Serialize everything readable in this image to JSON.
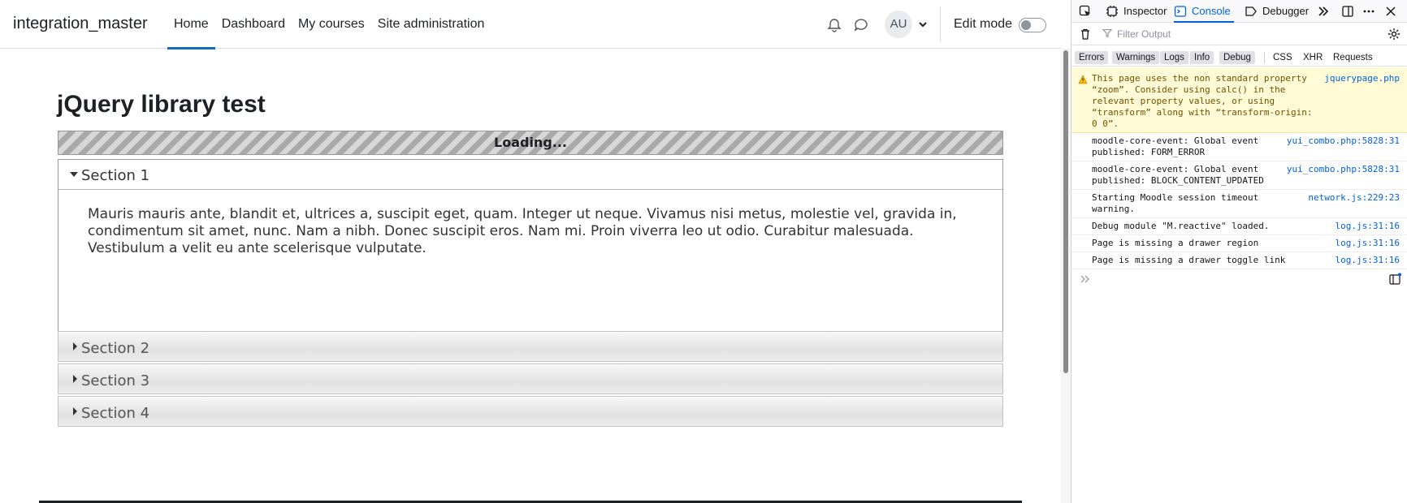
{
  "site": {
    "brand": "integration_master",
    "nav": [
      {
        "label": "Home",
        "active": true
      },
      {
        "label": "Dashboard",
        "active": false
      },
      {
        "label": "My courses",
        "active": false
      },
      {
        "label": "Site administration",
        "active": false
      }
    ],
    "user_initials": "AU",
    "edit_mode_label": "Edit mode",
    "edit_mode_on": false
  },
  "main": {
    "title": "jQuery library test",
    "loading_text": "Loading...",
    "sections": [
      {
        "label": "Section 1",
        "expanded": true,
        "body": "Mauris mauris ante, blandit et, ultrices a, suscipit eget, quam. Integer ut neque. Vivamus nisi metus, molestie vel, gravida in, condimentum sit amet, nunc. Nam a nibh. Donec suscipit eros. Nam mi. Proin viverra leo ut odio. Curabitur malesuada. Vestibulum a velit eu ante scelerisque vulputate."
      },
      {
        "label": "Section 2",
        "expanded": false
      },
      {
        "label": "Section 3",
        "expanded": false
      },
      {
        "label": "Section 4",
        "expanded": false
      }
    ]
  },
  "devtools": {
    "tabs": [
      "Inspector",
      "Console",
      "Debugger"
    ],
    "active_tab": "Console",
    "filter_placeholder": "Filter Output",
    "levels": [
      {
        "label": "Errors",
        "on": true
      },
      {
        "label": "Warnings",
        "on": true
      },
      {
        "label": "Logs",
        "on": true
      },
      {
        "label": "Info",
        "on": true
      },
      {
        "label": "Debug",
        "on": true
      },
      {
        "label": "CSS",
        "on": false
      },
      {
        "label": "XHR",
        "on": false
      },
      {
        "label": "Requests",
        "on": false
      }
    ],
    "messages": [
      {
        "type": "warning",
        "text": "This page uses the non standard property\n“zoom”. Consider using calc() in the\nrelevant property values, or using\n“transform” along with “transform-origin:\n0 0”.",
        "source": "jquerypage.php"
      },
      {
        "type": "log",
        "text": "moodle-core-event: Global event\npublished: FORM_ERROR",
        "source": "yui_combo.php:5828:31"
      },
      {
        "type": "log",
        "text": "moodle-core-event: Global event\npublished: BLOCK_CONTENT_UPDATED",
        "source": "yui_combo.php:5828:31"
      },
      {
        "type": "log",
        "text": "Starting Moodle session timeout\nwarning.",
        "source": "network.js:229:23"
      },
      {
        "type": "log",
        "text": "Debug module \"M.reactive\" loaded.",
        "source": "log.js:31:16"
      },
      {
        "type": "log",
        "text": "Page is missing a drawer region",
        "source": "log.js:31:16"
      },
      {
        "type": "log",
        "text": "Page is missing a drawer toggle link",
        "source": "log.js:31:16"
      }
    ],
    "icons": [
      "pick-element-icon",
      "inspector-icon",
      "console-icon",
      "debugger-icon",
      "more-tabs-icon",
      "dock-icon",
      "menu-icon",
      "close-icon",
      "trash-icon",
      "filter-icon",
      "settings-icon",
      "prompt-icon",
      "split-console-icon"
    ],
    "accent": "#0061e0",
    "warning_bg": "#fffbd6"
  },
  "colors": {
    "moodle_accent": "#0f6cbf",
    "text": "#1d2125"
  }
}
